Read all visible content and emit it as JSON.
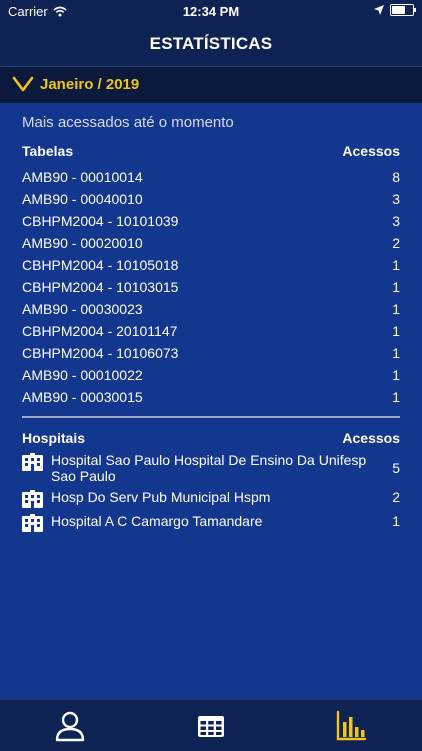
{
  "status_bar": {
    "carrier": "Carrier",
    "time": "12:34 PM"
  },
  "nav": {
    "title": "ESTATÍSTICAS"
  },
  "month": {
    "label": "Janeiro / 2019"
  },
  "content": {
    "subtitle": "Mais acessados até o momento",
    "tables_header": {
      "left": "Tabelas",
      "right": "Acessos"
    },
    "tables": [
      {
        "name": "AMB90 - 00010014",
        "count": "8"
      },
      {
        "name": "AMB90 - 00040010",
        "count": "3"
      },
      {
        "name": "CBHPM2004 - 10101039",
        "count": "3"
      },
      {
        "name": "AMB90 - 00020010",
        "count": "2"
      },
      {
        "name": "CBHPM2004 - 10105018",
        "count": "1"
      },
      {
        "name": "CBHPM2004 - 10103015",
        "count": "1"
      },
      {
        "name": "AMB90 - 00030023",
        "count": "1"
      },
      {
        "name": "CBHPM2004 - 20101147",
        "count": "1"
      },
      {
        "name": "CBHPM2004 - 10106073",
        "count": "1"
      },
      {
        "name": "AMB90 - 00010022",
        "count": "1"
      },
      {
        "name": "AMB90 - 00030015",
        "count": "1"
      }
    ],
    "hospitals_header": {
      "left": "Hospitais",
      "right": "Acessos"
    },
    "hospitals": [
      {
        "name": "Hospital Sao Paulo Hospital De Ensino Da Unifesp Sao Paulo",
        "count": "5"
      },
      {
        "name": "Hosp Do Serv Pub Municipal Hspm",
        "count": "2"
      },
      {
        "name": "Hospital A C Camargo Tamandare",
        "count": "1"
      }
    ]
  },
  "tabs": [
    {
      "icon": "user-icon"
    },
    {
      "icon": "table-icon"
    },
    {
      "icon": "bar-chart-icon",
      "active": true
    }
  ],
  "colors": {
    "accent": "#f0c419",
    "background": "#13378e",
    "header": "#0e2253"
  }
}
